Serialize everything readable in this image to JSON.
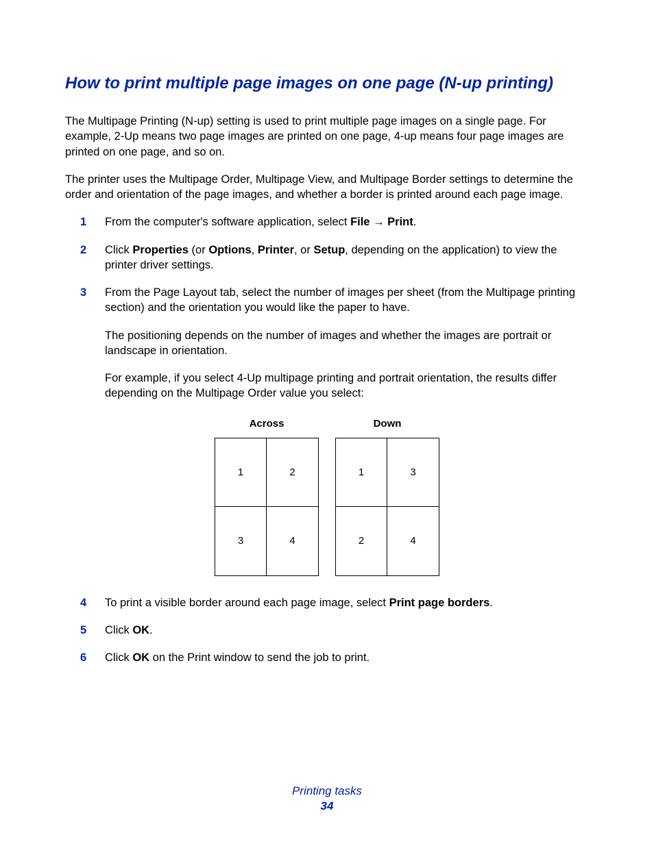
{
  "heading": "How to print multiple page images on one page (N-up printing)",
  "intro1": "The Multipage Printing (N-up) setting is used to print multiple page images on a single page. For example, 2-Up means two page images are printed on one page, 4-up means four page images are printed on one page, and so on.",
  "intro2_a": "The printer uses the Multipage Order, Multipage View, and Multipage Border settings to determine the order and orientation of the page images, and whether a border is printed around each page image.",
  "steps": {
    "s1": {
      "num": "1",
      "prefix": "From the computer's software application, select ",
      "bold1": "File",
      "arrow": " → ",
      "bold2": "Print",
      "suffix": "."
    },
    "s2": {
      "num": "2",
      "t1": "Click ",
      "b1": "Properties",
      "t2": " (or ",
      "b2": "Options",
      "t3": ", ",
      "b3": "Printer",
      "t4": ", or ",
      "b4": "Setup",
      "t5": ", depending on the application) to view the printer driver settings."
    },
    "s3": {
      "num": "3",
      "p1": "From the Page Layout tab, select the number of images per sheet (from the Multipage printing section) and the orientation you would like the paper to have.",
      "p2": "The positioning depends on the number of images and whether the images are portrait or landscape in orientation.",
      "p3": "For example, if you select 4-Up multipage printing and portrait orientation, the results differ depending on the Multipage Order value you select:"
    },
    "s4": {
      "num": "4",
      "t1": "To print a visible border around each page image, select ",
      "b1": "Print page borders",
      "t2": "."
    },
    "s5": {
      "num": "5",
      "t1": "Click ",
      "b1": "OK",
      "t2": "."
    },
    "s6": {
      "num": "6",
      "t1": "Click ",
      "b1": "OK",
      "t2": " on the Print window to send the job to print."
    }
  },
  "diagrams": {
    "across": {
      "title": "Across",
      "cells": [
        "1",
        "2",
        "3",
        "4"
      ]
    },
    "down": {
      "title": "Down",
      "cells": [
        "1",
        "3",
        "2",
        "4"
      ]
    }
  },
  "footer": {
    "section": "Printing tasks",
    "page": "34"
  }
}
